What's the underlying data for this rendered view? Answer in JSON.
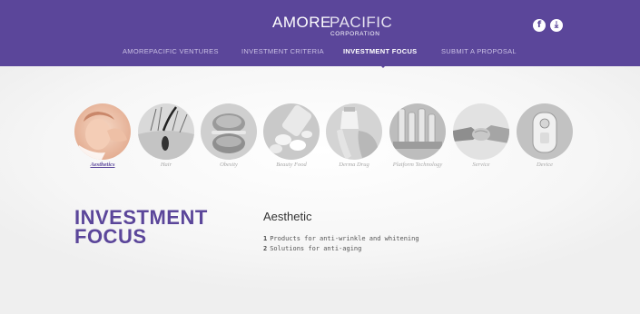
{
  "header": {
    "logo": {
      "brand_bold": "AMORE",
      "brand_light": "PACIFIC",
      "brand_sub": "CORPORATION"
    },
    "social": [
      {
        "icon": "facebook-icon",
        "glyph": "f"
      },
      {
        "icon": "download-icon",
        "glyph": "⤓"
      }
    ],
    "nav": [
      {
        "label": "AMOREPACIFIC VENTURES",
        "active": false
      },
      {
        "label": "INVESTMENT CRITERIA",
        "active": false
      },
      {
        "label": "INVESTMENT FOCUS",
        "active": true
      },
      {
        "label": "SUBMIT A PROPOSAL",
        "active": false
      }
    ],
    "accent": "#5b469a"
  },
  "categories": [
    {
      "label": "Aesthetics",
      "active": true
    },
    {
      "label": "Hair",
      "active": false
    },
    {
      "label": "Obesity",
      "active": false
    },
    {
      "label": "Beauty Food",
      "active": false
    },
    {
      "label": "Derma Drug",
      "active": false
    },
    {
      "label": "Platform Technology",
      "active": false
    },
    {
      "label": "Service",
      "active": false
    },
    {
      "label": "Device",
      "active": false
    }
  ],
  "main": {
    "title_line1": "INVESTMENT",
    "title_line2": "FOCUS",
    "detail": {
      "heading": "Aesthetic",
      "items": [
        {
          "num": "1",
          "text": "Products for anti-wrinkle and whitening"
        },
        {
          "num": "2",
          "text": "Solutions for anti-aging"
        }
      ]
    }
  }
}
